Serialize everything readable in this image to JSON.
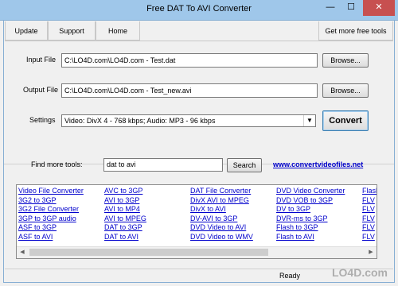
{
  "window": {
    "title": "Free DAT To AVI Converter",
    "minimize": "—",
    "maximize": "☐",
    "close": "✕"
  },
  "toolbar": {
    "update": "Update",
    "support": "Support",
    "home": "Home",
    "more_tools": "Get more free tools"
  },
  "input": {
    "label": "Input File",
    "value": "C:\\LO4D.com\\LO4D.com - Test.dat",
    "browse": "Browse..."
  },
  "output": {
    "label": "Output File",
    "value": "C:\\LO4D.com\\LO4D.com - Test_new.avi",
    "browse": "Browse..."
  },
  "settings": {
    "label": "Settings",
    "value": "Video: DivX 4 - 768 kbps; Audio: MP3 - 96 kbps",
    "dropdown_icon": "▼",
    "convert": "Convert"
  },
  "find": {
    "label": "Find more tools:",
    "query": "dat to avi",
    "search": "Search",
    "site": "www.convertvideofiles.net"
  },
  "tools": {
    "col1": [
      "Video File Converter",
      "3G2 to 3GP",
      "3G2 File Converter",
      "3GP to 3GP audio",
      "ASF to 3GP",
      "ASF to AVI"
    ],
    "col2": [
      "AVC to 3GP",
      "AVI to 3GP",
      "AVI to MP4",
      "AVI to MPEG",
      "DAT to 3GP",
      "DAT to AVI"
    ],
    "col3": [
      "DAT File Converter",
      "DivX AVI to MPEG",
      "DivX to AVI",
      "DV-AVI to 3GP",
      "DVD Video to AVI",
      "DVD Video to WMV"
    ],
    "col4": [
      "DVD Video Converter",
      "DVD VOB to 3GP",
      "DV to 3GP",
      "DVR-ms to 3GP",
      "Flash to 3GP",
      "Flash to AVI"
    ],
    "col5": [
      "Flash",
      "FLV",
      "FLV",
      "FLV",
      "FLV",
      "FLV"
    ]
  },
  "status": {
    "text": "Ready",
    "watermark": "LO4D.com"
  }
}
